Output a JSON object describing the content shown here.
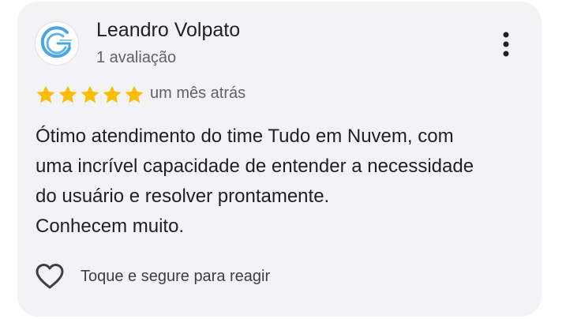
{
  "review": {
    "reviewer_name": "Leandro Volpato",
    "review_count": "1 avaliação",
    "rating": 5,
    "rating_max": 5,
    "time_ago": "um mês atrás",
    "text_lines": [
      "Ótimo atendimento do time Tudo em Nuvem, com",
      "uma incrível capacidade de entender a necessidade",
      "do usuário e resolver prontamente.",
      "Conhecem muito."
    ],
    "react_label": "Toque e segure para reagir"
  },
  "icons": {
    "avatar": "tudo-em-nuvem-logo",
    "menu": "more-vertical-icon",
    "star": "star-icon",
    "react": "heart-outline-icon"
  },
  "colors": {
    "star": "#fbbc04",
    "card_background": "#f3f3f6",
    "text_primary": "#202124",
    "text_secondary": "#5f6368",
    "logo_blue": "#4aa6e0"
  }
}
